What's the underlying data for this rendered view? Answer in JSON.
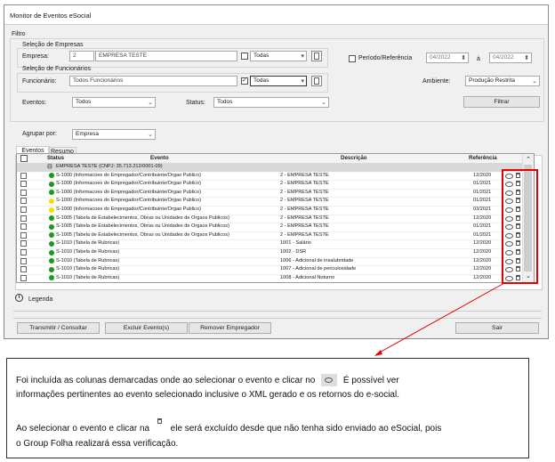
{
  "window": {
    "title": "Monitor de Eventos eSocial"
  },
  "filtro": {
    "label": "Filtro",
    "empresas": {
      "section": "Seleção de Empresas",
      "label": "Empresa:",
      "code": "2",
      "name": "EMPRESA TESTE",
      "todas": "Todas"
    },
    "periodo": {
      "label": "Período/Referência",
      "from": "04/2022",
      "to_label": "à",
      "to": "04/2022"
    },
    "funcionarios": {
      "section": "Seleção de Funcionários",
      "label": "Funcionário:",
      "value": "Todos Funcionários",
      "todas": "Todas"
    },
    "ambiente": {
      "label": "Ambiente:",
      "value": "Produção Restrita"
    },
    "eventos": {
      "label": "Eventos:",
      "value": "Todos"
    },
    "status": {
      "label": "Status:",
      "value": "Todos"
    },
    "filtrar": "Filtrar",
    "agrupar": {
      "label": "Agrupar por:",
      "value": "Empresa"
    }
  },
  "tabs": [
    "Eventos",
    "Resumo"
  ],
  "grid": {
    "headers": {
      "status": "Status",
      "evento": "Evento",
      "descricao": "Descrição",
      "referencia": "Referência"
    },
    "group_label": "EMPRESA TESTE (CNPJ: 35.713.212/0001-09)",
    "rows": [
      {
        "color": "#1a9a1a",
        "evento": "S-1000 (Informacoes do Empregador/Contribuinte/Orgao Publico)",
        "descricao": "2 - EMPRESA TESTE",
        "ref": "12/2020"
      },
      {
        "color": "#1a9a1a",
        "evento": "S-1000 (Informacoes do Empregador/Contribuinte/Orgao Publico)",
        "descricao": "2 - EMPRESA TESTE",
        "ref": "01/2021"
      },
      {
        "color": "#1a9a1a",
        "evento": "S-1000 (Informacoes do Empregador/Contribuinte/Orgao Publico)",
        "descricao": "2 - EMPRESA TESTE",
        "ref": "01/2021"
      },
      {
        "color": "#f0e000",
        "evento": "S-1000 (Informacoes do Empregador/Contribuinte/Orgao Publico)",
        "descricao": "2 - EMPRESA TESTE",
        "ref": "01/2021"
      },
      {
        "color": "#f0e000",
        "evento": "S-1000 (Informacoes do Empregador/Contribuinte/Orgao Publico)",
        "descricao": "2 - EMPRESA TESTE",
        "ref": "03/2021"
      },
      {
        "color": "#1a9a1a",
        "evento": "S-1005 (Tabela de Estabelecimentos, Obras ou Unidades de Orgaos Publicos)",
        "descricao": "2 - EMPRESA TESTE",
        "ref": "12/2020"
      },
      {
        "color": "#1a9a1a",
        "evento": "S-1005 (Tabela de Estabelecimentos, Obras ou Unidades de Orgaos Publicos)",
        "descricao": "2 - EMPRESA TESTE",
        "ref": "01/2021"
      },
      {
        "color": "#1a9a1a",
        "evento": "S-1005 (Tabela de Estabelecimentos, Obras ou Unidades de Orgaos Publicos)",
        "descricao": "2 - EMPRESA TESTE",
        "ref": "01/2021"
      },
      {
        "color": "#1a9a1a",
        "evento": "S-1010 (Tabela de Rubricas)",
        "descricao": "1001 - Salário",
        "ref": "12/2020"
      },
      {
        "color": "#1a9a1a",
        "evento": "S-1010 (Tabela de Rubricas)",
        "descricao": "1002 - DSR",
        "ref": "12/2020"
      },
      {
        "color": "#1a9a1a",
        "evento": "S-1010 (Tabela de Rubricas)",
        "descricao": "1006 - Adicional de insalubridade",
        "ref": "12/2020"
      },
      {
        "color": "#1a9a1a",
        "evento": "S-1010 (Tabela de Rubricas)",
        "descricao": "1007 - Adicional de periculosidade",
        "ref": "12/2020"
      },
      {
        "color": "#1a9a1a",
        "evento": "S-1010 (Tabela de Rubricas)",
        "descricao": "1008 - Adicional Noturno",
        "ref": "12/2020"
      }
    ]
  },
  "legenda": "Legenda",
  "buttons": {
    "transmitir": "Transmitir / Consultar",
    "excluir": "Excluir Evento(s)",
    "remover": "Remover Empregador",
    "sair": "Sair"
  },
  "note": {
    "p1a": "Foi incluída as colunas demarcadas onde ao selecionar o evento e clicar no",
    "p1b": "É possível ver",
    "p1c": "informações pertinentes ao evento selecionado inclusive o XML gerado e os retornos do e-social.",
    "p2a": "Ao selecionar o evento e clicar na",
    "p2b": "ele será excluído desde que não tenha sido enviado ao eSocial, pois",
    "p2c": "o Group Folha realizará essa verificação."
  }
}
